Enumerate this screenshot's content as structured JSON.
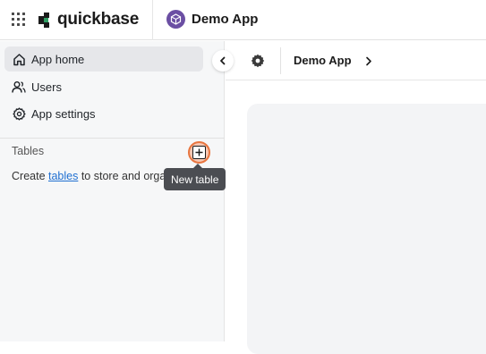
{
  "topbar": {
    "brand_name": "quickbase",
    "app_title": "Demo App",
    "brand_colors": {
      "mark_dark": "#1b1b1b",
      "mark_green": "#2f9e63",
      "app_badge": "#6b4fa3"
    }
  },
  "sidebar": {
    "items": [
      {
        "label": "App home",
        "icon": "home-icon",
        "active": true
      },
      {
        "label": "Users",
        "icon": "users-icon",
        "active": false
      },
      {
        "label": "App settings",
        "icon": "settings-gear-icon",
        "active": false
      }
    ],
    "tables_heading": "Tables",
    "hint_prefix": "Create ",
    "hint_link": "tables",
    "hint_suffix": " to store and organize your data"
  },
  "tooltip": {
    "text": "New table"
  },
  "content_header": {
    "breadcrumb": "Demo App"
  },
  "colors": {
    "accent_focus_ring": "#e8753f",
    "link": "#1f6fd1",
    "tooltip_bg": "#4b4d52"
  }
}
